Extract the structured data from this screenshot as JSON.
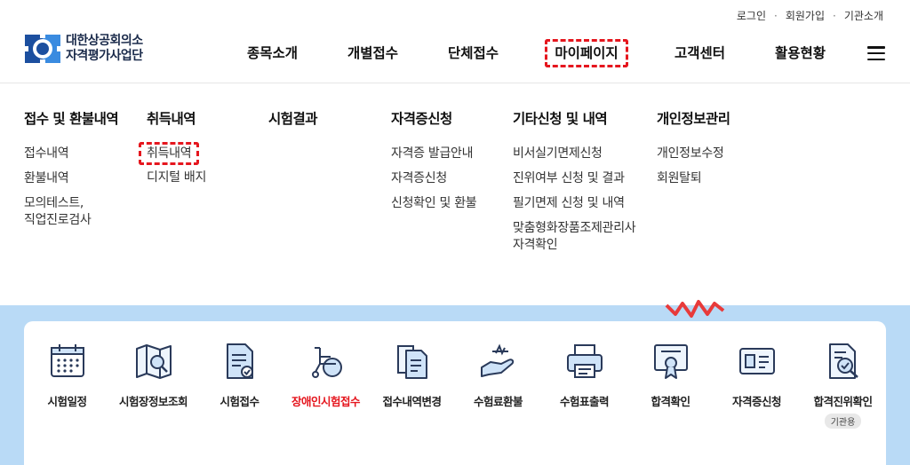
{
  "utility_links": [
    {
      "label": "로그인"
    },
    {
      "label": "회원가입"
    },
    {
      "label": "기관소개"
    }
  ],
  "logo": {
    "line1": "대한상공회의소",
    "line2": "자격평가사업단"
  },
  "gnb": [
    {
      "label": "종목소개"
    },
    {
      "label": "개별접수"
    },
    {
      "label": "단체접수"
    },
    {
      "label": "마이페이지",
      "active": true
    },
    {
      "label": "고객센터"
    },
    {
      "label": "활용현황"
    }
  ],
  "mega_menu": {
    "columns": [
      {
        "title": "접수 및 환불내역",
        "items": [
          "접수내역",
          "환불내역",
          "모의테스트,",
          "직업진로검사"
        ]
      },
      {
        "title": "취득내역",
        "items": [
          "취득내역",
          "디지털 배지"
        ]
      },
      {
        "title": "시험결과",
        "items": []
      },
      {
        "title": "자격증신청",
        "items": [
          "자격증 발급안내",
          "자격증신청",
          "신청확인 및 환불"
        ]
      },
      {
        "title": "기타신청 및 내역",
        "items": [
          "비서실기면제신청",
          "진위여부 신청 및 결과",
          "필기면제 신청 및 내역",
          "맞춤형화장품조제관리사",
          "자격확인"
        ]
      },
      {
        "title": "개인정보관리",
        "items": [
          "개인정보수정",
          "회원탈퇴"
        ]
      }
    ]
  },
  "quick_menu": [
    {
      "label": "시험일정",
      "icon": "calendar-icon"
    },
    {
      "label": "시험장정보조회",
      "icon": "map-search-icon"
    },
    {
      "label": "시험접수",
      "icon": "document-check-icon"
    },
    {
      "label": "장애인시험접수",
      "icon": "wheelchair-icon",
      "highlight": "#e5161e"
    },
    {
      "label": "접수내역변경",
      "icon": "documents-edit-icon"
    },
    {
      "label": "수험료환불",
      "icon": "hand-money-icon"
    },
    {
      "label": "수험표출력",
      "icon": "printer-icon"
    },
    {
      "label": "합격확인",
      "icon": "certificate-icon"
    },
    {
      "label": "자격증신청",
      "icon": "id-card-icon"
    },
    {
      "label": "합격진위확인",
      "icon": "document-search-icon",
      "badge": "기관용"
    }
  ],
  "colors": {
    "accent_blue": "#2b74d4",
    "highlight_red": "#e5161e",
    "hero_bg": "#b9daf6"
  }
}
